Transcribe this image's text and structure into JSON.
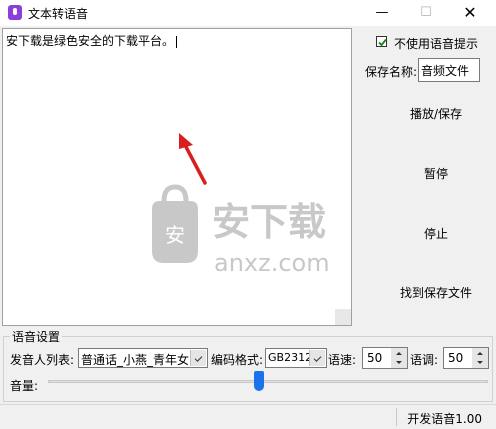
{
  "window": {
    "title": "文本转语音",
    "minimize_label": "—",
    "maximize_label": "☐",
    "close_label": "✕"
  },
  "editor": {
    "text": "安下载是绿色安全的下载平台。"
  },
  "watermark": {
    "logo_text": "安",
    "brand_text": "安下载",
    "domain_text": "anxz.com"
  },
  "options": {
    "disable_prompt_label": "不使用语音提示",
    "disable_prompt_checked": true,
    "save_name_label": "保存名称:",
    "save_name_value": "音频文件"
  },
  "actions": {
    "play_save": "播放/保存",
    "pause": "暂停",
    "stop": "停止",
    "find_file": "找到保存文件"
  },
  "voice_settings": {
    "group_title": "语音设置",
    "speaker_label": "发音人列表:",
    "speaker_value": "普通话_小燕_青年女",
    "encoding_label": "编码格式:",
    "encoding_value": "GB2312",
    "speed_label": "语速:",
    "speed_value": "50",
    "pitch_label": "语调:",
    "pitch_value": "50",
    "volume_label": "音量:",
    "volume_level_percent": 48
  },
  "status": {
    "text": "开发语音1.00"
  },
  "colors": {
    "accent": "#1a73e8",
    "arrow": "#d81e1e",
    "watermark": "#c8c8c8"
  },
  "icons": {
    "app": "microphone-icon",
    "check": "checkmark-icon"
  }
}
